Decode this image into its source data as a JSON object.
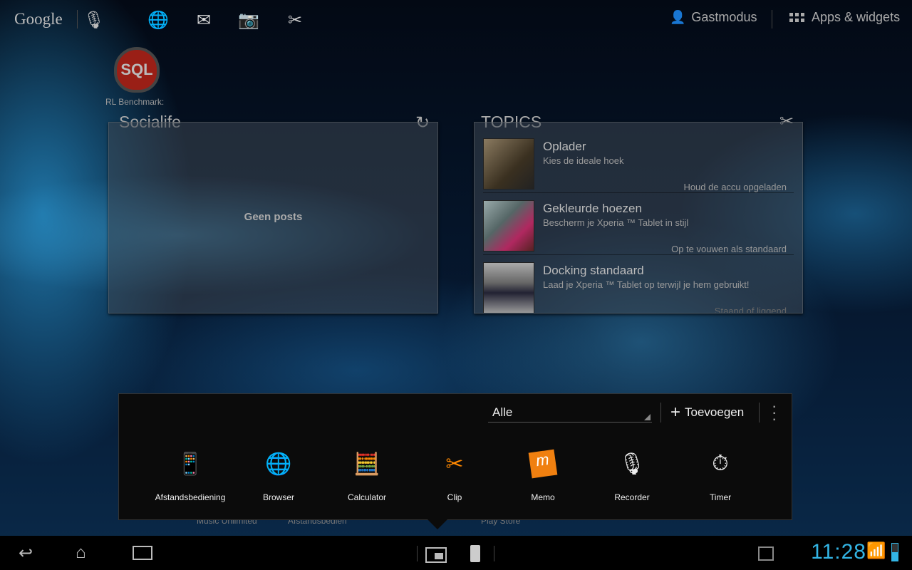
{
  "topbar": {
    "search_label": "Google",
    "guest_mode": "Gastmodus",
    "apps_widgets": "Apps & widgets"
  },
  "desktop_icon": {
    "logo_text": "SQL",
    "label": "RL Benchmark:"
  },
  "socialife": {
    "title": "Socialife",
    "empty": "Geen posts"
  },
  "topics": {
    "title": "TOPICS",
    "items": [
      {
        "title": "Oplader",
        "subtitle": "Kies de ideale hoek",
        "tag": "Houd de accu opgeladen"
      },
      {
        "title": "Gekleurde hoezen",
        "subtitle": "Bescherm je Xperia ™ Tablet in stijl",
        "tag": "Op te vouwen als standaard"
      },
      {
        "title": "Docking standaard",
        "subtitle": "Laad je Xperia ™ Tablet op terwijl je hem gebruikt!",
        "tag": "Staand of liggend"
      }
    ]
  },
  "popup": {
    "filter": "Alle",
    "add_label": "Toevoegen",
    "apps": [
      "Afstandsbediening",
      "Browser",
      "Calculator",
      "Clip",
      "Memo",
      "Recorder",
      "Timer"
    ]
  },
  "behind_labels": [
    "Music Unlimited",
    "Afstandsbedien",
    "Play Store"
  ],
  "status": {
    "time": "11:28",
    "accent": "#33b5e5"
  }
}
